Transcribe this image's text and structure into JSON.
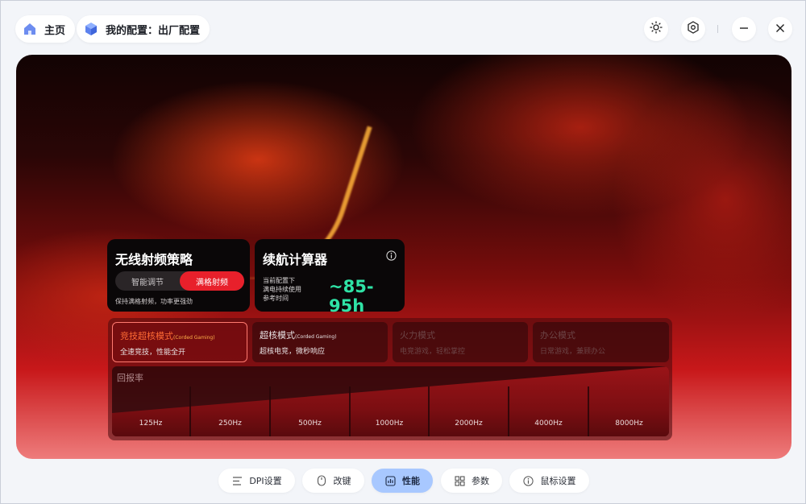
{
  "header": {
    "home_label": "主页",
    "config_label": "我的配置：出厂配置"
  },
  "wireless_card": {
    "title": "无线射频策略",
    "options": [
      "智能调节",
      "满格射频"
    ],
    "selected": "满格射频",
    "note": "保持满格射频，功率更强劲"
  },
  "battery_card": {
    "title": "续航计算器",
    "lines": [
      "当前配置下",
      "满电持续使用",
      "参考时间"
    ],
    "value": "~85-95h"
  },
  "modes": [
    {
      "name": "竞技超核模式",
      "tag": "(Corded Gaming)",
      "desc": "全速竞技，性能全开",
      "state": "active"
    },
    {
      "name": "超核模式",
      "tag": "(Corded Gaming)",
      "desc": "超核电竞，微秒响应",
      "state": "normal"
    },
    {
      "name": "火力模式",
      "tag": "",
      "desc": "电竞游戏，轻松掌控",
      "state": "dim"
    },
    {
      "name": "办公模式",
      "tag": "",
      "desc": "日常游戏，兼顾办公",
      "state": "dim"
    }
  ],
  "polling": {
    "label": "回报率",
    "rates": [
      "125Hz",
      "250Hz",
      "500Hz",
      "1000Hz",
      "2000Hz",
      "4000Hz",
      "8000Hz"
    ]
  },
  "bottom_nav": [
    {
      "label": "DPI设置",
      "icon": "dpi-icon",
      "active": false
    },
    {
      "label": "改键",
      "icon": "mouse-icon",
      "active": false
    },
    {
      "label": "性能",
      "icon": "performance-icon",
      "active": true
    },
    {
      "label": "参数",
      "icon": "grid-icon",
      "active": false
    },
    {
      "label": "鼠标设置",
      "icon": "info-icon",
      "active": false
    }
  ],
  "colors": {
    "accent_red": "#e8202b",
    "battery_green": "#2fe3a6",
    "nav_active": "#a8c8ff"
  }
}
